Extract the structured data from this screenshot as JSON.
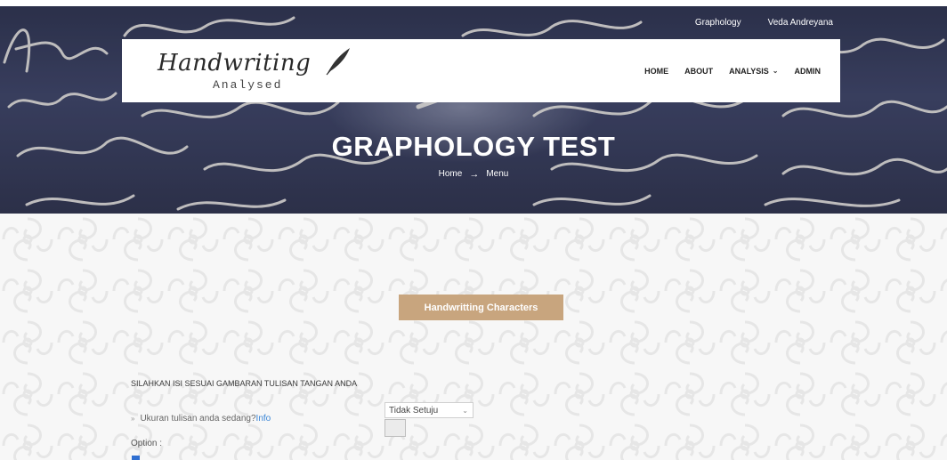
{
  "top_links": [
    "Graphology",
    "Veda Andreyana"
  ],
  "logo": {
    "script_text": "Handwriting",
    "sub_text": "Analysed",
    "icon": "quill-icon"
  },
  "nav": {
    "items": [
      {
        "label": "HOME"
      },
      {
        "label": "ABOUT"
      },
      {
        "label": "ANALYSIS",
        "has_dropdown": true,
        "chevron": "⌄"
      },
      {
        "label": "ADMIN"
      }
    ]
  },
  "hero": {
    "title": "GRAPHOLOGY TEST",
    "breadcrumb": {
      "home": "Home",
      "separator": "→",
      "current": "Menu"
    }
  },
  "main": {
    "characters_button": "Handwritting Characters",
    "instruction": "SILAHKAN ISI SESUAI GAMBARAN TULISAN TANGAN ANDA",
    "question": {
      "bullet": "»",
      "text": "Ukuran tulisan anda sedang?",
      "info_link": "Info"
    },
    "select": {
      "selected": "Tidak Setuju",
      "chevron": "⌄"
    },
    "option_label": "Option :"
  },
  "colors": {
    "accent": "#c8a57e",
    "link": "#3b86d6",
    "hero_bg": "#3a4060"
  }
}
